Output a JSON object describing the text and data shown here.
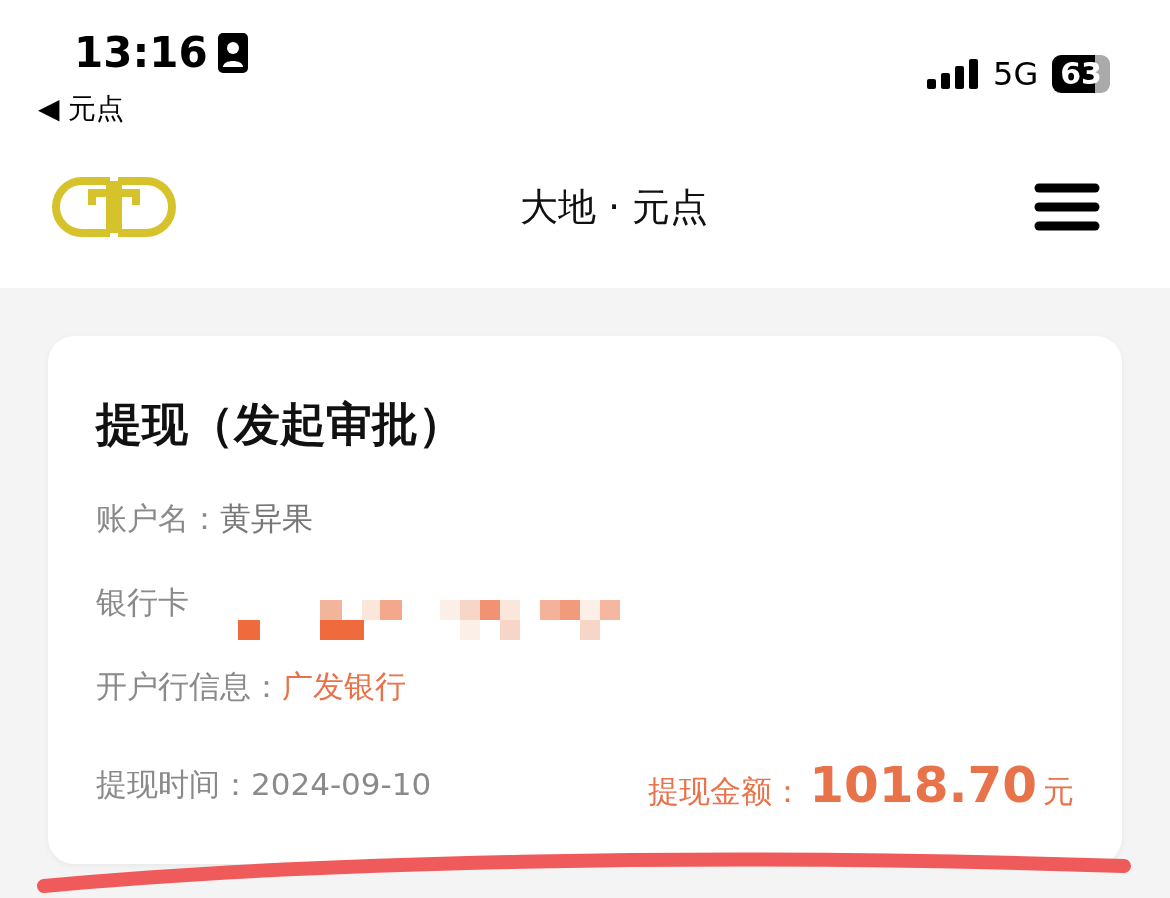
{
  "status_bar": {
    "time": "13:16",
    "network": "5G",
    "battery": "63",
    "back_label": "◀ 元点"
  },
  "header": {
    "title": "大地 · 元点"
  },
  "card": {
    "title": "提现（发起审批）",
    "account_label": "账户名：",
    "account_value": "黄异果",
    "card_label": "银行卡",
    "bank_label": "开户行信息：",
    "bank_value": "广发银行",
    "time_label": "提现时间：",
    "time_value": "2024-09-10",
    "amount_label": "提现金额：",
    "amount_value": "1018.70",
    "amount_unit": "元"
  }
}
